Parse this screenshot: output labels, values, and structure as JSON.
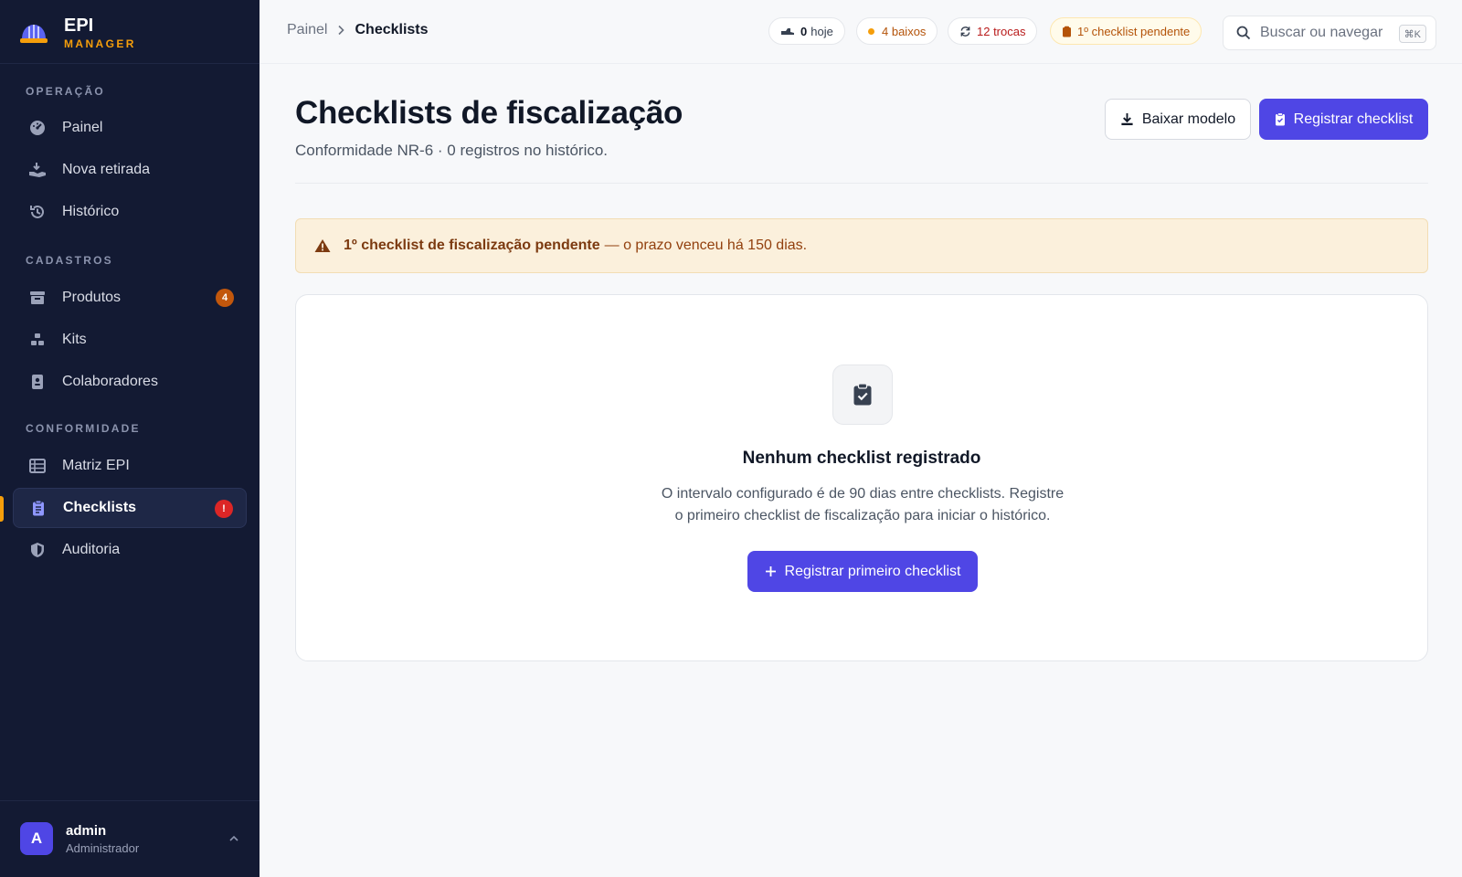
{
  "brand": {
    "title": "EPI",
    "subtitle": "MANAGER"
  },
  "sidebar": {
    "sections": [
      {
        "label": "OPERAÇÃO"
      },
      {
        "label": "CADASTROS"
      },
      {
        "label": "CONFORMIDADE"
      }
    ],
    "items": [
      {
        "label": "Painel",
        "icon": "dashboard-icon"
      },
      {
        "label": "Nova retirada",
        "icon": "hand-withdraw-icon"
      },
      {
        "label": "Histórico",
        "icon": "history-icon"
      },
      {
        "label": "Produtos",
        "icon": "box-icon",
        "badge": "4"
      },
      {
        "label": "Kits",
        "icon": "kits-icon"
      },
      {
        "label": "Colaboradores",
        "icon": "id-badge-icon"
      },
      {
        "label": "Matriz EPI",
        "icon": "matrix-table-icon"
      },
      {
        "label": "Checklists",
        "icon": "clipboard-icon",
        "badge": "!",
        "active": true
      },
      {
        "label": "Auditoria",
        "icon": "shield-icon"
      }
    ]
  },
  "user": {
    "initial": "A",
    "name": "admin",
    "role": "Administrador"
  },
  "breadcrumb": {
    "parent": "Painel",
    "current": "Checklists"
  },
  "status_pills": {
    "today_count": "0",
    "today_label": "hoje",
    "low": "4 baixos",
    "swaps": "12 trocas",
    "pending": "1º checklist pendente"
  },
  "search": {
    "placeholder": "Buscar ou navegar",
    "shortcut": "⌘K"
  },
  "page": {
    "title": "Checklists de fiscalização",
    "subtitle": "Conformidade NR-6 · 0 registros no histórico."
  },
  "actions": {
    "download": "Baixar modelo",
    "register": "Registrar checklist"
  },
  "alert": {
    "strong": "1º checklist de fiscalização pendente",
    "text": "— o prazo venceu há 150 dias."
  },
  "empty_state": {
    "title": "Nenhum checklist registrado",
    "desc_line1": "O intervalo configurado é de 90 dias entre checklists. Registre",
    "desc_line2": "o primeiro checklist de fiscalização para iniciar o histórico.",
    "button": "Registrar primeiro checklist"
  },
  "colors": {
    "sidebar_bg": "#131a33",
    "accent": "#4f46e5",
    "brand_accent": "#f59e0b",
    "alert_bg": "#fbf0dc",
    "alert_text": "#92400e"
  }
}
